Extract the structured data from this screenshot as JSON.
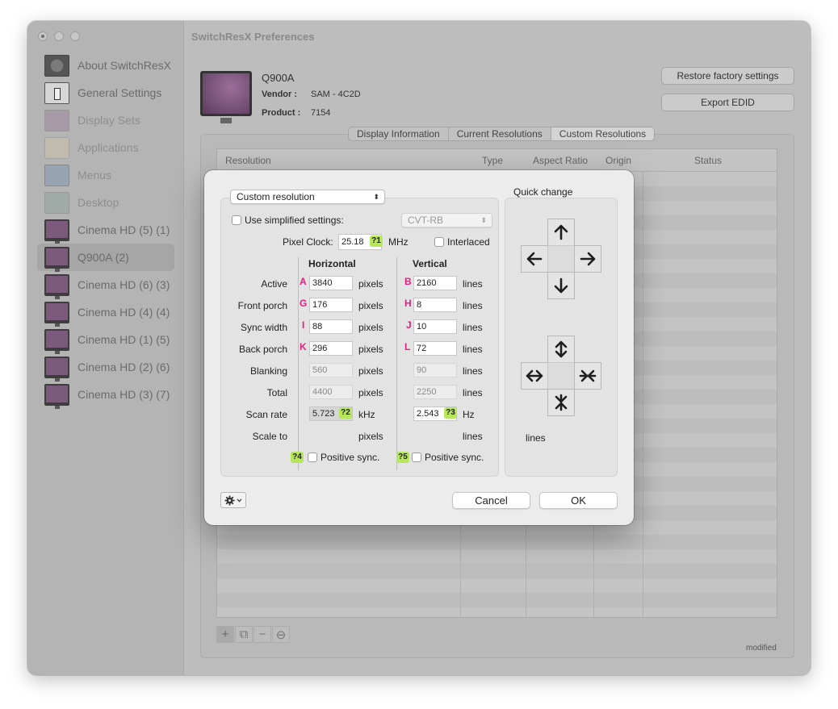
{
  "window": {
    "title": "SwitchResX Preferences"
  },
  "sidebar": {
    "items": [
      {
        "label": "About SwitchResX",
        "icon": "about-icon"
      },
      {
        "label": "General Settings",
        "icon": "general-settings-icon"
      },
      {
        "label": "Display Sets",
        "icon": "display-sets-icon"
      },
      {
        "label": "Applications",
        "icon": "applications-icon"
      },
      {
        "label": "Menus",
        "icon": "menus-icon"
      },
      {
        "label": "Desktop",
        "icon": "desktop-icon"
      },
      {
        "label": "Cinema HD (5) (1)",
        "icon": "monitor-icon"
      },
      {
        "label": "Q900A (2)",
        "icon": "monitor-icon",
        "selected": true
      },
      {
        "label": "Cinema HD (6) (3)",
        "icon": "monitor-icon"
      },
      {
        "label": "Cinema HD (4) (4)",
        "icon": "monitor-icon"
      },
      {
        "label": "Cinema HD (1) (5)",
        "icon": "monitor-icon"
      },
      {
        "label": "Cinema HD (2) (6)",
        "icon": "monitor-icon"
      },
      {
        "label": "Cinema HD (3) (7)",
        "icon": "monitor-icon"
      }
    ]
  },
  "display": {
    "name": "Q900A",
    "vendor_label": "Vendor :",
    "vendor": "SAM - 4C2D",
    "product_label": "Product :",
    "product": "7154"
  },
  "buttons": {
    "restore": "Restore factory settings",
    "export": "Export EDID"
  },
  "tabs": [
    {
      "label": "Display Information"
    },
    {
      "label": "Current Resolutions"
    },
    {
      "label": "Custom Resolutions",
      "active": true
    }
  ],
  "table": {
    "headers": [
      "Resolution",
      "Type",
      "Aspect Ratio",
      "Origin",
      "Status"
    ],
    "buttons": [
      "+",
      "⧉",
      "−",
      "⊖"
    ],
    "footer": "modified"
  },
  "dialog": {
    "mode": "Custom resolution",
    "simplified_label": "Use simplified settings:",
    "simplified_checked": false,
    "timing_standard": "CVT-RB",
    "pixel_clock_label": "Pixel Clock:",
    "pixel_clock": "25.18",
    "pixel_clock_unit": "MHz",
    "interlaced_label": "Interlaced",
    "interlaced_checked": false,
    "horizontal_header": "Horizontal",
    "vertical_header": "Vertical",
    "rows": [
      {
        "label": "Active",
        "h_letter": "A",
        "h": "3840",
        "h_unit": "pixels",
        "v_letter": "B",
        "v": "2160",
        "v_unit": "lines"
      },
      {
        "label": "Front porch",
        "h_letter": "G",
        "h": "176",
        "h_unit": "pixels",
        "v_letter": "H",
        "v": "8",
        "v_unit": "lines"
      },
      {
        "label": "Sync width",
        "h_letter": "I",
        "h": "88",
        "h_unit": "pixels",
        "v_letter": "J",
        "v": "10",
        "v_unit": "lines"
      },
      {
        "label": "Back porch",
        "h_letter": "K",
        "h": "296",
        "h_unit": "pixels",
        "v_letter": "L",
        "v": "72",
        "v_unit": "lines"
      },
      {
        "label": "Blanking",
        "h": "560",
        "h_unit": "pixels",
        "v": "90",
        "v_unit": "lines"
      },
      {
        "label": "Total",
        "h": "4400",
        "h_unit": "pixels",
        "v": "2250",
        "v_unit": "lines"
      },
      {
        "label": "Scan rate",
        "h": "5.723",
        "h_unit": "kHz",
        "v": "2.543",
        "v_unit": "Hz"
      },
      {
        "label": "Scale to",
        "h": "",
        "h_unit": "pixels",
        "v": "",
        "v_unit": "lines"
      }
    ],
    "warnings": {
      "w1": "?1",
      "w2": "?2",
      "w3": "?3",
      "w4": "?4",
      "w5": "?5"
    },
    "h_positive_sync": "Positive sync.",
    "v_positive_sync": "Positive sync.",
    "quick_change_title": "Quick change",
    "quick_change_unit": "lines",
    "cancel": "Cancel",
    "ok": "OK",
    "colors": {
      "letter": "#e0217f",
      "warning_bg": "#b6e65a"
    }
  }
}
